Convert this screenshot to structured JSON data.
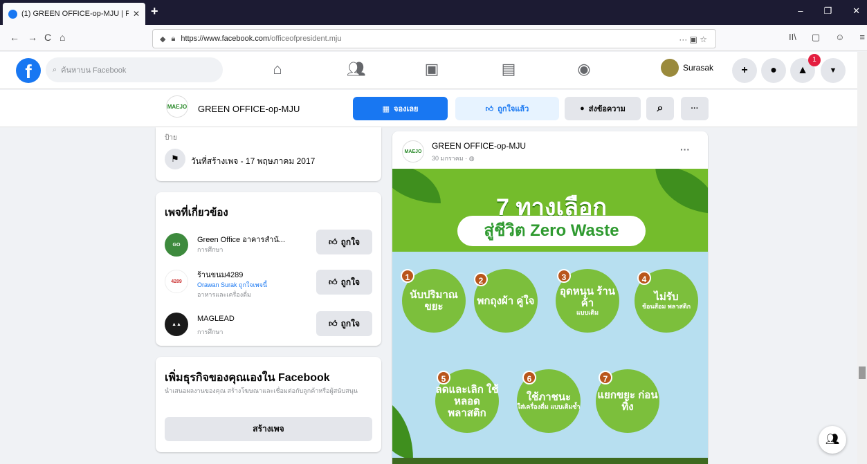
{
  "browser": {
    "tab_title": "(1) GREEN OFFICE-op-MJU | F",
    "tab_close": "✕",
    "new_tab": "+",
    "url_host": "https://www.facebook.com",
    "url_path": "/officeofpresident.mju",
    "nav_back": "←",
    "nav_forward": "→",
    "nav_reload": "C",
    "nav_home": "⌂",
    "url_actions": "··· ▣ ☆",
    "right_tools": [
      "II\\",
      "▢",
      "☺",
      "≡"
    ],
    "win_min": "–",
    "win_max": "❐",
    "win_close": "✕"
  },
  "fb_header": {
    "logo": "f",
    "search_placeholder": "ค้นหาบน Facebook",
    "user_name": "Surasak",
    "notif_count": "1"
  },
  "page_bar": {
    "avatar_text": "MAEJO",
    "page_name": "GREEN OFFICE-op-MJU",
    "book_label": "จองเลย",
    "liked_label": "ถูกใจแล้ว",
    "message_label": "ส่งข้อความ",
    "search_icon": "⌕",
    "more_label": "···"
  },
  "about_card": {
    "label": "ป้าย",
    "created": "วันที่สร้างเพจ - 17 พฤษภาคม 2017"
  },
  "related": {
    "title": "เพจที่เกี่ยวข้อง",
    "like_label": "ถูกใจ",
    "items": [
      {
        "name": "Green Office อาคารสำนั...",
        "sub": "การศึกษา",
        "sub2": ""
      },
      {
        "name": "ร้านขนม4289",
        "sub": "Orawan Surak ถูกใจเพจนี้",
        "sub2": "อาหารและเครื่องดื่ม"
      },
      {
        "name": "MAGLEAD",
        "sub": "การศึกษา",
        "sub2": ""
      }
    ]
  },
  "business_card": {
    "title": "เพิ่มธุรกิจของคุณเองใน Facebook",
    "desc": "นำเสนอผลงานของคุณ สร้างโฆษณาและเชื่อมต่อกับลูกค้าหรือผู้สนับสนุน",
    "button": "สร้างเพจ"
  },
  "post": {
    "page_name": "GREEN OFFICE-op-MJU",
    "time": "30 มกราคม · ◍",
    "more": "···",
    "image": {
      "title": "7 ทางเลือก",
      "subtitle": "สู่ชีวิต Zero Waste",
      "bubbles": [
        {
          "n": "1",
          "main": "นับปริมาณ ขยะ",
          "sub": ""
        },
        {
          "n": "2",
          "main": "พกถุงผ้า คู่ใจ",
          "sub": ""
        },
        {
          "n": "3",
          "main": "อุดหนุน ร้านค้า",
          "sub": "แบบเติม"
        },
        {
          "n": "4",
          "main": "ไม่รับ",
          "sub": "ช้อนส้อม พลาสติก"
        },
        {
          "n": "5",
          "main": "ลดและเลิก ใช้หลอด พลาสติก",
          "sub": ""
        },
        {
          "n": "6",
          "main": "ใช้ภาชนะ",
          "sub": "ใส่เครื่องดื่ม แบบเติมซ้ำ"
        },
        {
          "n": "7",
          "main": "แยกขยะ ก่อนทิ้ง",
          "sub": ""
        }
      ]
    }
  },
  "colors": {
    "fb_blue": "#1877f2",
    "green": "#7cbf3c",
    "sky": "#b7dff0"
  }
}
